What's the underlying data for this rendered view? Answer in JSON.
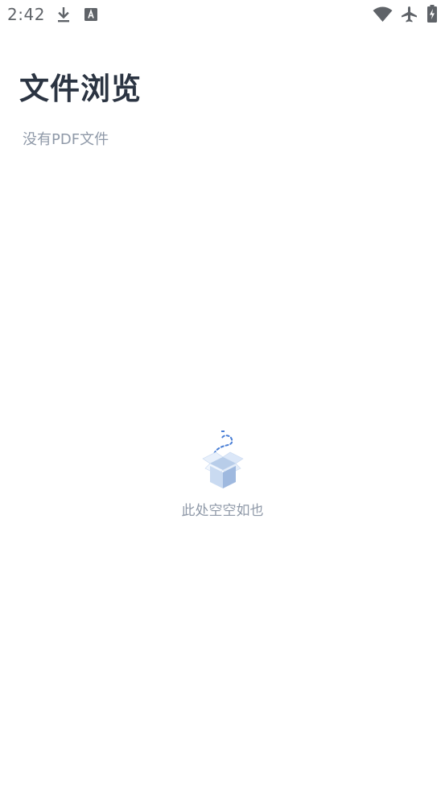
{
  "status_bar": {
    "time": "2:42",
    "icons": [
      "download-icon",
      "keyboard-a-icon",
      "wifi-icon",
      "airplane-icon",
      "battery-charging-icon"
    ]
  },
  "page": {
    "title": "文件浏览",
    "empty_hint": "没有PDF文件"
  },
  "empty_state": {
    "illustration": "open-box-icon",
    "text": "此处空空如也"
  },
  "colors": {
    "title": "#2b3442",
    "muted_text": "#8f99a8",
    "status_icons": "#5f6368",
    "accent_blue": "#4a7fd6"
  }
}
